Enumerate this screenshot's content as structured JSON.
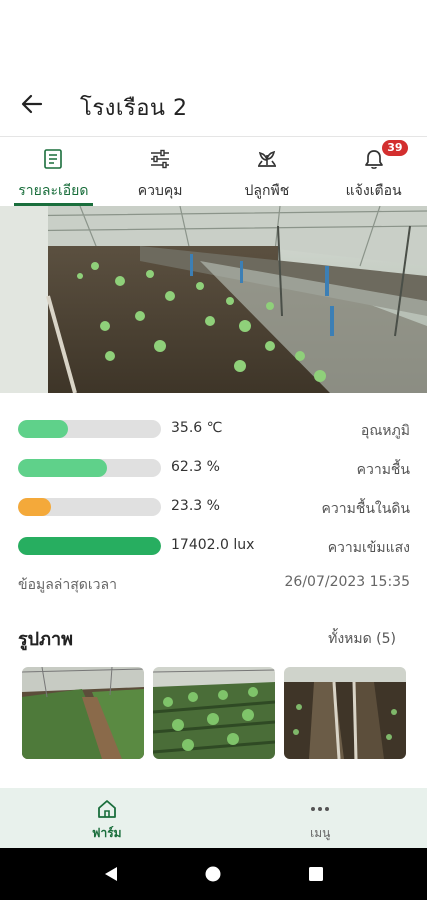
{
  "header": {
    "title": "โรงเรือน 2",
    "back_icon": "arrow-left-icon"
  },
  "tabs": [
    {
      "label": "รายละเอียด",
      "icon": "document-icon",
      "active": true
    },
    {
      "label": "ควบคุม",
      "icon": "sliders-icon",
      "active": false
    },
    {
      "label": "ปลูกพืช",
      "icon": "sprout-icon",
      "active": false
    },
    {
      "label": "แจ้งเตือน",
      "icon": "bell-icon",
      "active": false,
      "badge": "39"
    }
  ],
  "sensors": [
    {
      "label": "อุณหภูมิ",
      "value": "35.6 ℃",
      "level": 0.35,
      "color": "#5fd18a"
    },
    {
      "label": "ความชื้น",
      "value": "62.3 %",
      "level": 0.623,
      "color": "#5fd18a"
    },
    {
      "label": "ความชื้นในดิน",
      "value": "23.3 %",
      "level": 0.233,
      "color": "#f4a93a"
    },
    {
      "label": "ความเข้มแสง",
      "value": "17402.0 lux",
      "level": 1.0,
      "color": "#27ae60"
    }
  ],
  "updated": {
    "label": "ข้อมูลล่าสุดเวลา",
    "timestamp": "26/07/2023 15:35"
  },
  "photos": {
    "title": "รูปภาพ",
    "all_label": "ทั้งหมด (5)"
  },
  "bottom_nav": [
    {
      "label": "ฟาร์ม",
      "icon": "home-icon",
      "active": true
    },
    {
      "label": "เมนู",
      "icon": "more-dots-icon",
      "active": false
    }
  ],
  "colors": {
    "accent": "#1a6e3c",
    "badge": "#d32f2f",
    "nav_bg": "#e8f1ec"
  }
}
